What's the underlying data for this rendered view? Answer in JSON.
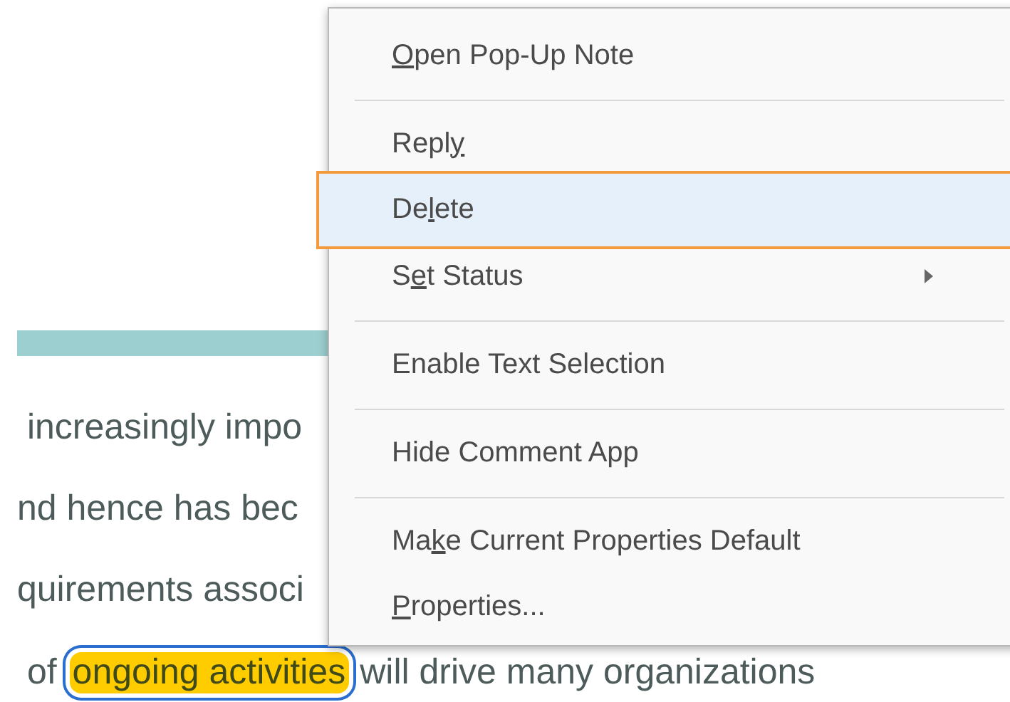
{
  "document": {
    "lines": [
      {
        "parts": [
          {
            "text": " increasingly impo",
            "highlighted": false
          }
        ]
      },
      {
        "parts": [
          {
            "text": "nd hence has bec",
            "highlighted": false
          }
        ]
      },
      {
        "parts": [
          {
            "text": "quirements associ",
            "highlighted": false
          }
        ]
      },
      {
        "parts": [
          {
            "text": " of",
            "highlighted": false
          },
          {
            "text": "ongoing activities",
            "highlighted": true
          },
          {
            "text": "will drive many organizations",
            "highlighted": false
          }
        ]
      }
    ]
  },
  "context_menu": {
    "items": [
      {
        "kind": "item",
        "access_key": "O",
        "label_after": "pen Pop-Up Note",
        "selected": false,
        "submenu": false
      },
      {
        "kind": "separator"
      },
      {
        "kind": "item",
        "label_before": "Repl",
        "access_key": "y",
        "selected": false,
        "submenu": false
      },
      {
        "kind": "item",
        "label_before": "De",
        "access_key": "l",
        "label_after": "ete",
        "selected": true,
        "submenu": false
      },
      {
        "kind": "item",
        "label_before": "S",
        "access_key": "e",
        "label_after": "t Status",
        "selected": false,
        "submenu": true
      },
      {
        "kind": "separator"
      },
      {
        "kind": "item",
        "label_before": "Enable Text Selection",
        "selected": false,
        "submenu": false
      },
      {
        "kind": "separator"
      },
      {
        "kind": "item",
        "label_before": "Hide Comment App",
        "selected": false,
        "submenu": false
      },
      {
        "kind": "separator"
      },
      {
        "kind": "item",
        "label_before": "Ma",
        "access_key": "k",
        "label_after": "e Current Properties Default",
        "selected": false,
        "submenu": false
      },
      {
        "kind": "item",
        "access_key": "P",
        "label_after": "roperties...",
        "selected": false,
        "submenu": false
      }
    ]
  }
}
